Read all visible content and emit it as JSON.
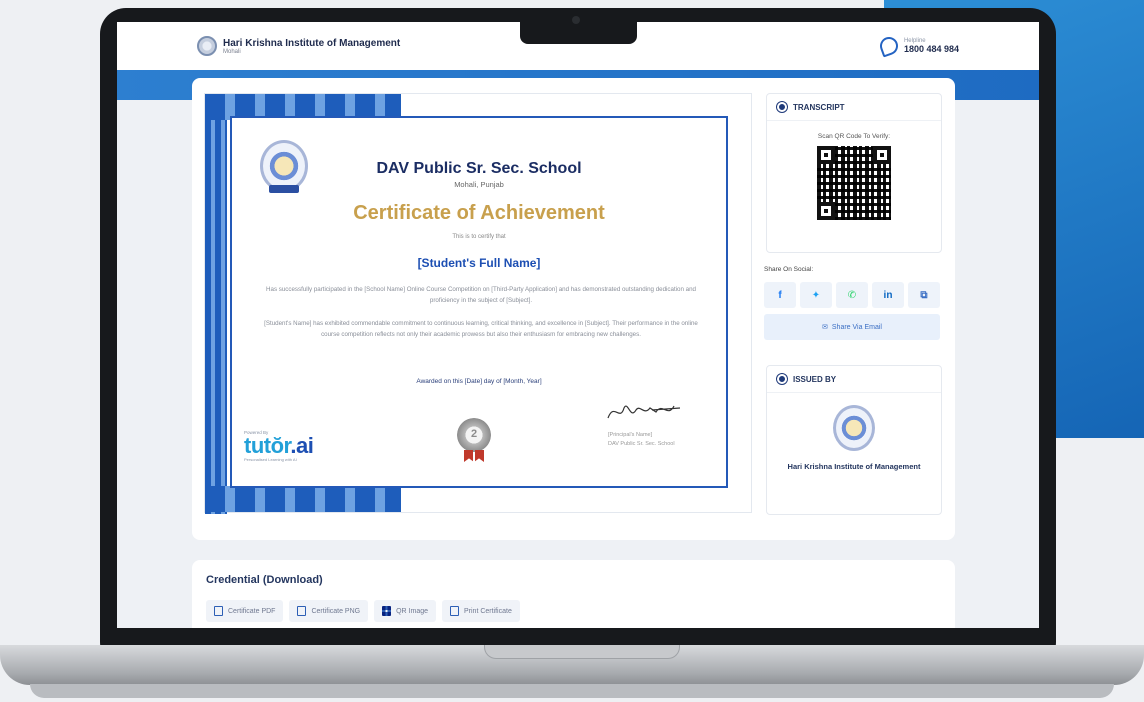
{
  "header": {
    "institute": "Hari Krishna Institute of Management",
    "city": "Mohali",
    "helpline_label": "Helpline",
    "helpline_number": "1800 484 984"
  },
  "certificate": {
    "school": "DAV Public Sr. Sec. School",
    "location": "Mohali, Punjab",
    "title": "Certificate of Achievement",
    "certify": "This is to certify that",
    "student": "[Student's Full Name]",
    "para1": "Has successfully participated in the [School Name] Online Course Competition on [Third-Party Application] and has demonstrated outstanding dedication and proficiency in the subject of [Subject].",
    "para2": "[Student's Name] has exhibited commendable commitment to continuous learning, critical thinking, and excellence in [Subject]. Their performance in the online course competition reflects not only their academic prowess but also their enthusiasm for embracing new challenges.",
    "awarded": "Awarded on this [Date] day of [Month, Year]",
    "powered_by": "Powered By",
    "tutor_a": "tut",
    "tutor_b": "ŏr",
    "tutor_c": ".ai",
    "tutor_tag": "Personalised Learning with AI",
    "medal": "2",
    "principal_name": "[Principal's Name]",
    "principal_school": "DAV Public Sr. Sec. School"
  },
  "transcript": {
    "heading": "TRANSCRIPT",
    "scan_label": "Scan QR Code To Verify:"
  },
  "share": {
    "label": "Share On Social:",
    "icons": [
      "f",
      "✦",
      "✆",
      "in",
      "⧉"
    ],
    "email": "Share Via Email"
  },
  "issued": {
    "heading": "ISSUED BY",
    "name": "Hari Krishna Institute of Management"
  },
  "credential": {
    "title": "Credential (Download)",
    "buttons": [
      "Certificate PDF",
      "Certificate PNG",
      "QR Image",
      "Print Certificate"
    ]
  },
  "colors": {
    "primary": "#1e5dbb",
    "gold": "#c8a04d",
    "accent": "#22a0d8"
  }
}
